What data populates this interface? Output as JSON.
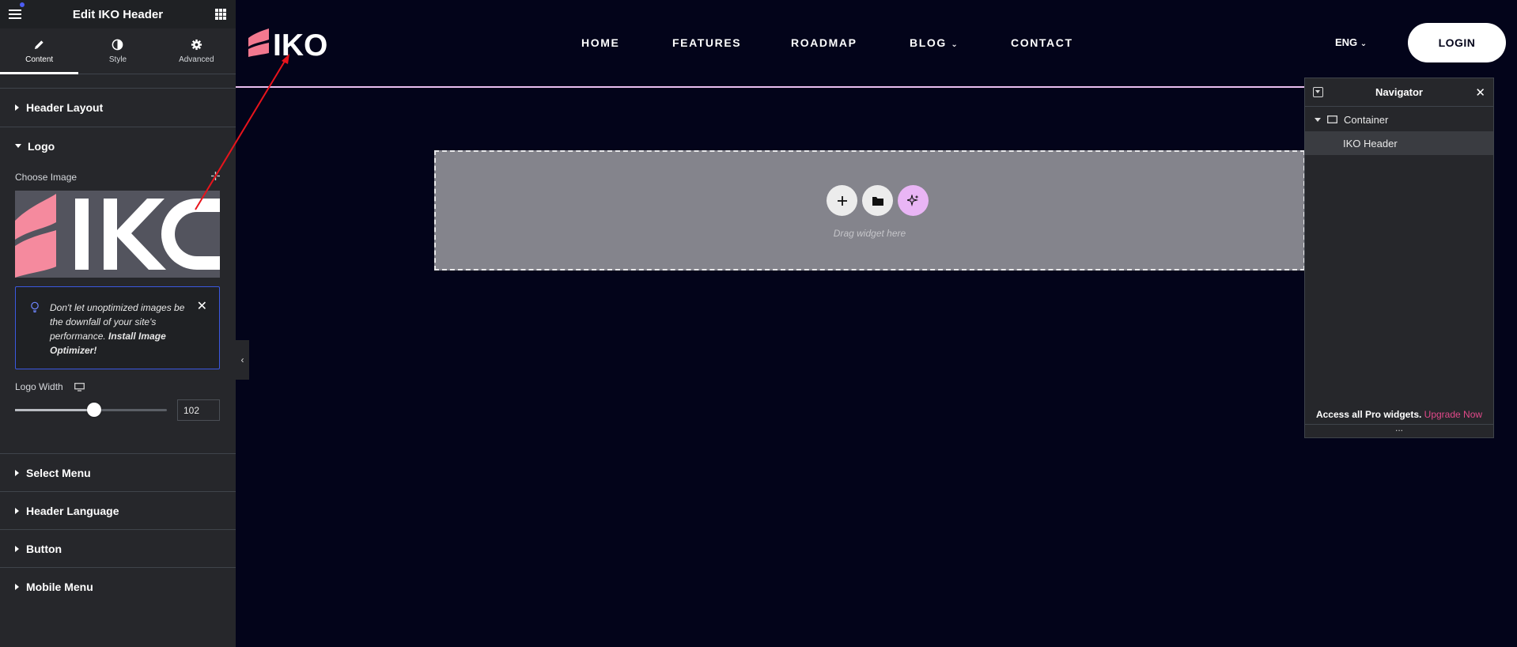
{
  "panel": {
    "title": "Edit IKO Header",
    "tabs": [
      {
        "label": "Content",
        "icon": "pencil-icon",
        "active": true
      },
      {
        "label": "Style",
        "icon": "contrast-icon",
        "active": false
      },
      {
        "label": "Advanced",
        "icon": "gear-icon",
        "active": false
      }
    ],
    "sections": {
      "header_layout": "Header Layout",
      "logo": "Logo",
      "select_menu": "Select Menu",
      "header_language": "Header Language",
      "button": "Button",
      "mobile_menu": "Mobile Menu"
    },
    "logo": {
      "choose_image_label": "Choose Image",
      "preview_text": "IKO",
      "notice_text": "Don't let unoptimized images be the downfall of your site's performance.",
      "notice_link": "Install Image Optimizer!",
      "logo_width_label": "Logo Width",
      "logo_width_value": "102",
      "slider_level": 0.52
    }
  },
  "site": {
    "logo_text": "IKO",
    "nav": [
      "HOME",
      "FEATURES",
      "ROADMAP",
      "BLOG",
      "CONTACT"
    ],
    "language": "ENG",
    "login_label": "LOGIN",
    "dropzone_text": "Drag widget here"
  },
  "navigator": {
    "title": "Navigator",
    "items": [
      "Container",
      "IKO Header"
    ],
    "footer_text": "Access all Pro widgets.",
    "footer_link": "Upgrade Now",
    "dots": "..."
  },
  "colors": {
    "canvas_bg": "#03041a",
    "panel_bg": "#26272b",
    "brand_pink": "#f2788f",
    "ai_button": "#e9b5f5",
    "upgrade_link": "#e2498a",
    "notice_border": "#3b58e0"
  }
}
